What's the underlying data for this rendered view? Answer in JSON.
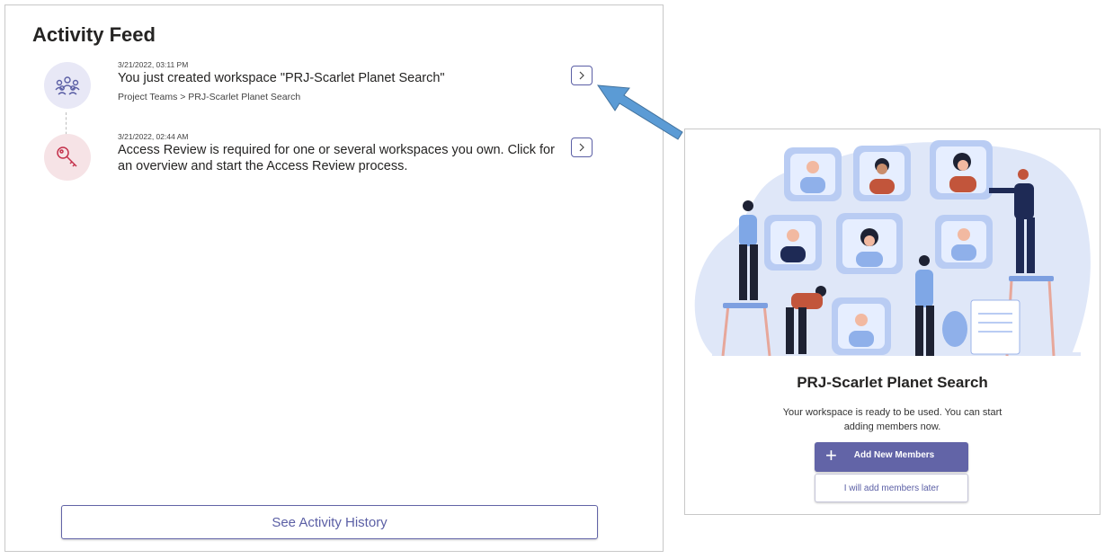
{
  "feed": {
    "title": "Activity Feed",
    "items": [
      {
        "date": "3/21/2022, 03:11 PM",
        "text": "You just created workspace \"PRJ-Scarlet Planet Search\"",
        "path": "Project Teams > PRJ-Scarlet Planet Search",
        "icon": "team-icon"
      },
      {
        "date": "3/21/2022, 02:44 AM",
        "text_line1": "Access Review is required for one or several workspaces you own. Click for",
        "text_line2": "an overview and start the Access Review process.",
        "icon": "key-icon"
      }
    ],
    "history_button": "See Activity History"
  },
  "workspace_card": {
    "name": "PRJ-Scarlet Planet Search",
    "description_line1": "Your workspace is ready to be used. You can start",
    "description_line2": "adding members now.",
    "add_button": "Add New Members",
    "later_button": "I will add members later"
  },
  "colors": {
    "accent": "#6264a7",
    "arrow": "#5b9bd5",
    "key_icon": "#c4314b"
  }
}
